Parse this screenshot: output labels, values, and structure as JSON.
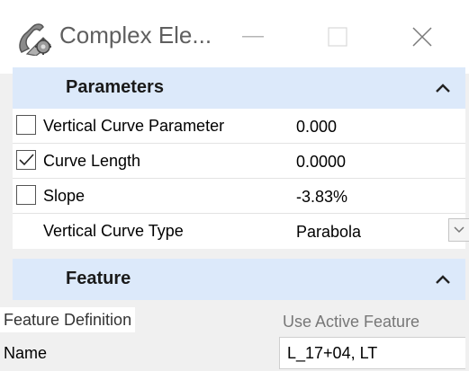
{
  "window": {
    "title": "Complex Ele...",
    "icon": "complex-element-icon"
  },
  "parameters": {
    "header": "Parameters",
    "rows": [
      {
        "label": "Vertical Curve Parameter",
        "value": "0.000",
        "checked": false
      },
      {
        "label": "Curve Length",
        "value": "0.0000",
        "checked": true
      },
      {
        "label": "Slope",
        "value": "-3.83%",
        "checked": false
      },
      {
        "label": "Vertical Curve Type",
        "value": "Parabola"
      }
    ]
  },
  "feature": {
    "header": "Feature",
    "definition_label": "Feature Definition",
    "definition_value": "Use Active Feature",
    "name_label": "Name",
    "name_value": "L_17+04, LT"
  },
  "colors": {
    "section_header": "#dce9fa",
    "background": "#f0f0f0"
  }
}
